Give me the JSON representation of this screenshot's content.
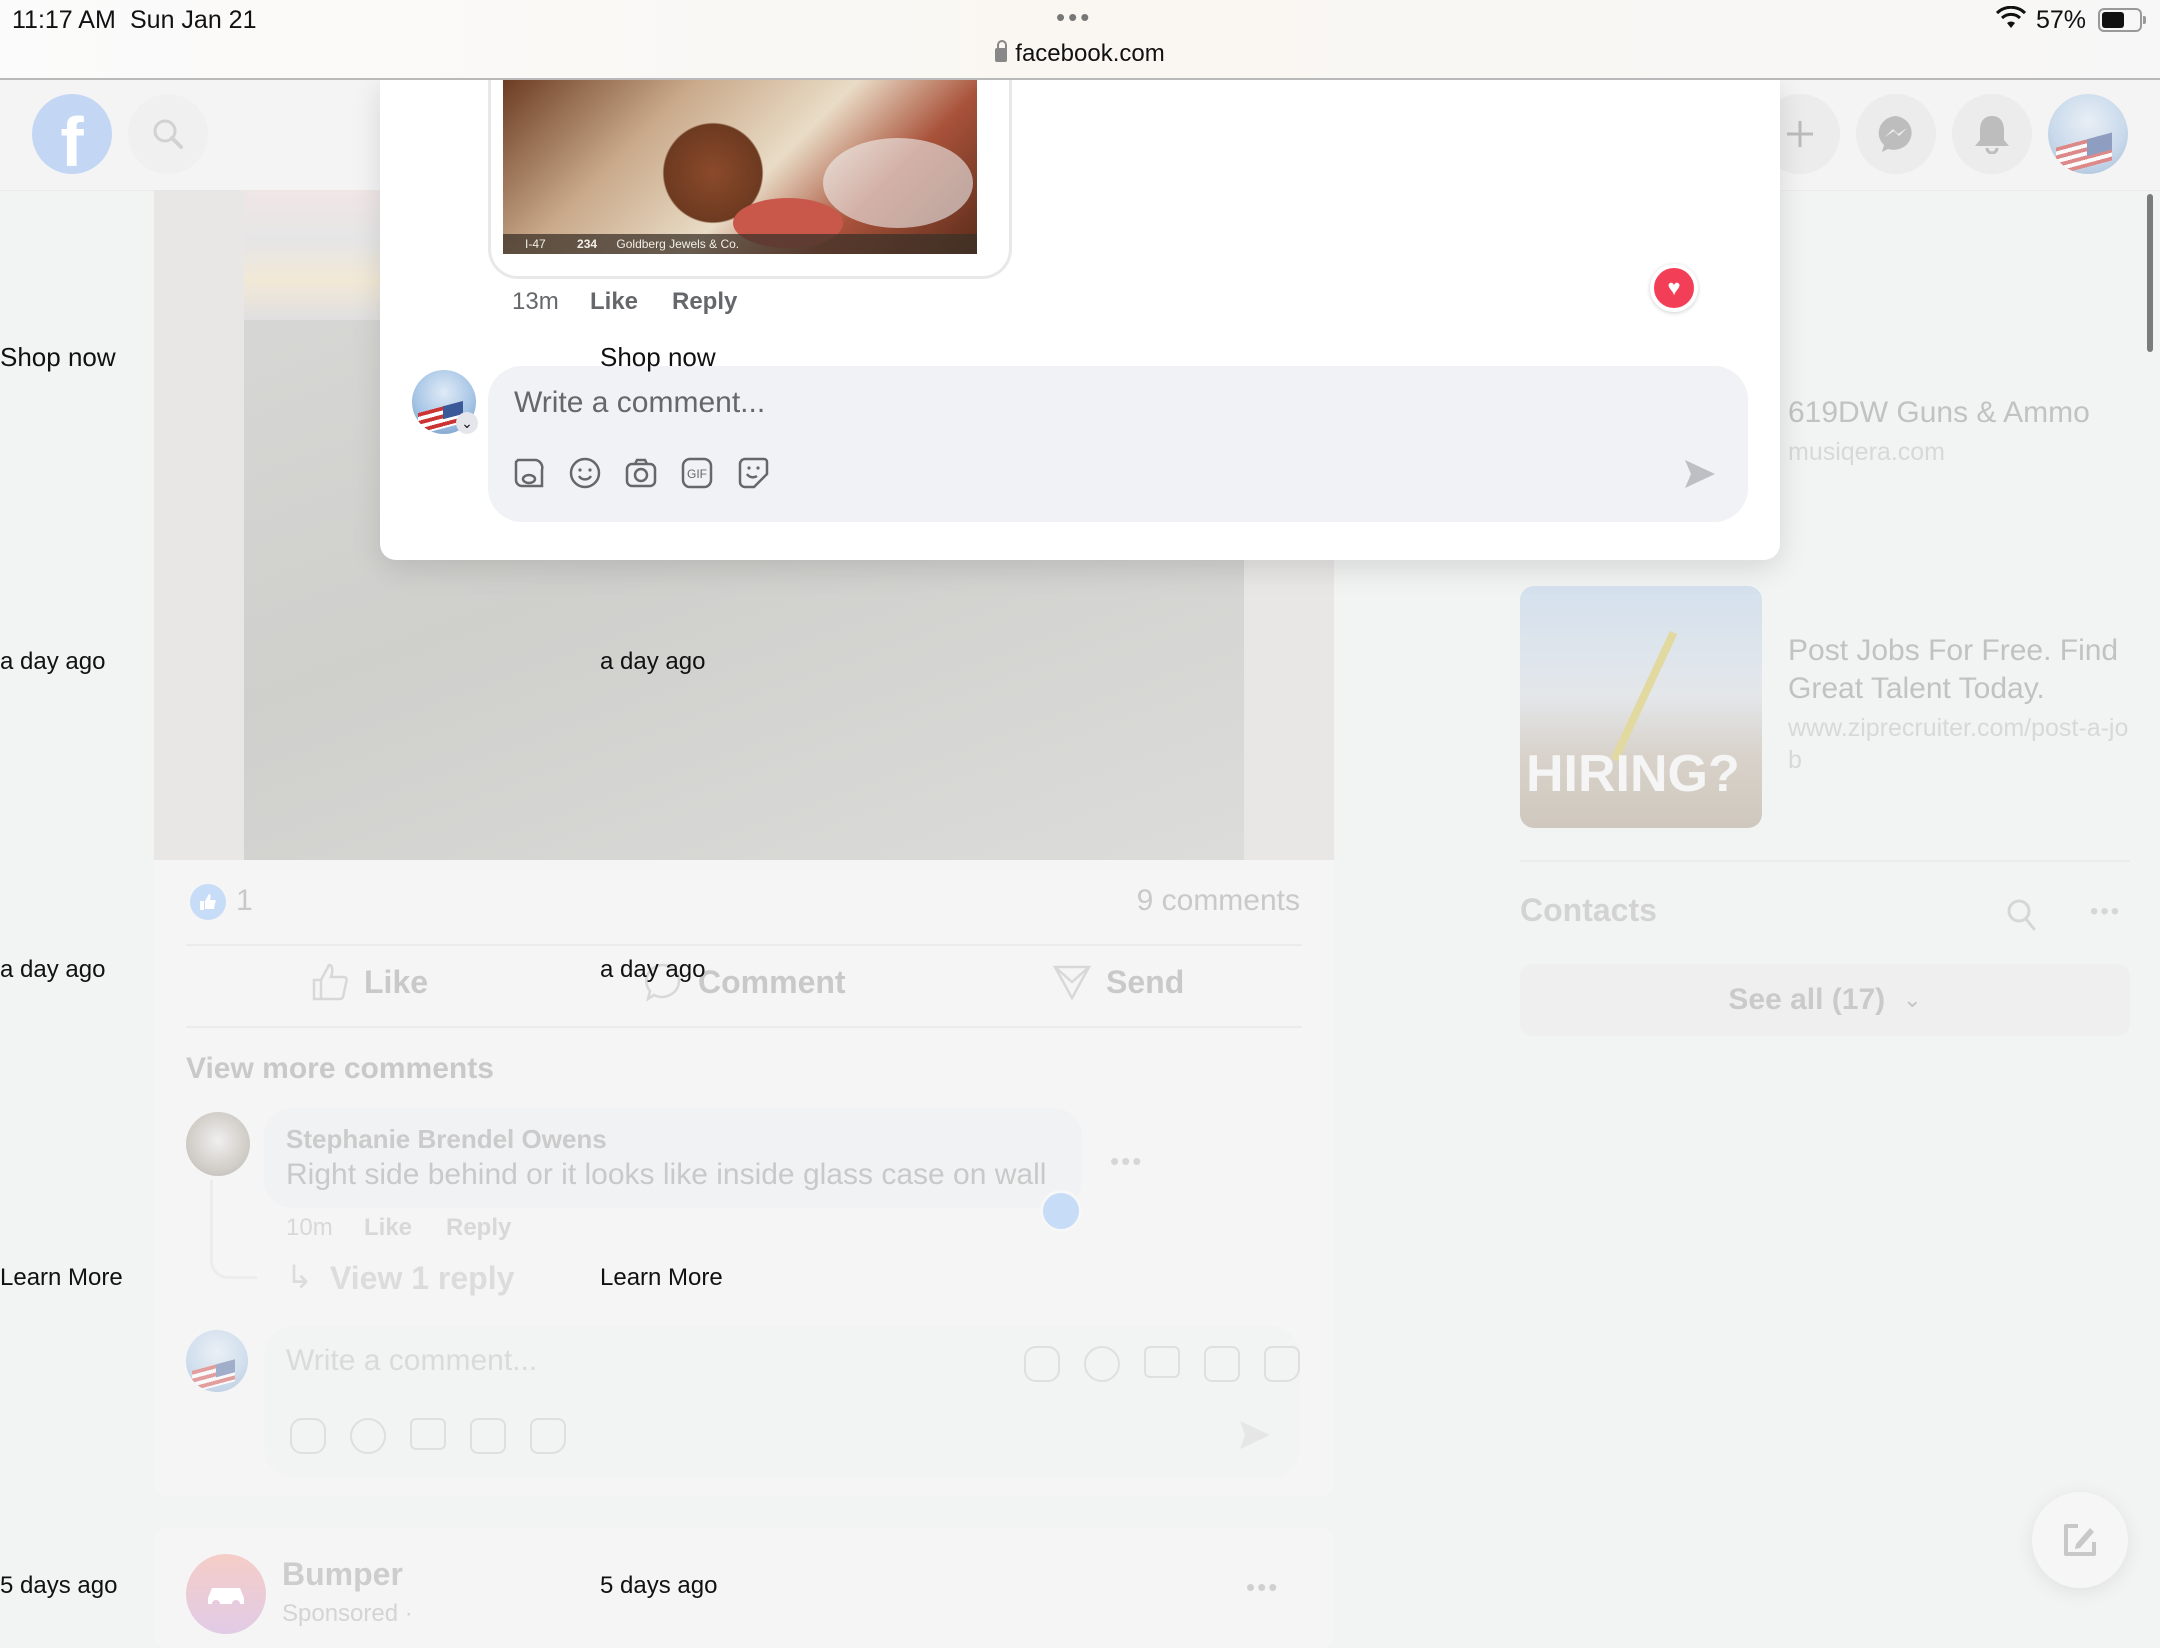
{
  "status_bar": {
    "time": "11:17 AM",
    "date": "Sun Jan 21",
    "dots": "•••",
    "url": "facebook.com",
    "battery_pct": "57%",
    "battery_level": 0.57
  },
  "fb_header": {
    "logo": "f",
    "icons": [
      "search-icon",
      "plus-icon",
      "messenger-icon",
      "bell-icon",
      "profile-avatar"
    ]
  },
  "modal": {
    "image_caption": {
      "level": "I-47",
      "score": "234",
      "location": "Goldberg Jewels & Co."
    },
    "comment_time": "13m",
    "like": "Like",
    "reply": "Reply",
    "reaction": "love",
    "composer_placeholder": "Write a comment...",
    "composer_tools": [
      "avatar-sticker-icon",
      "emoji-icon",
      "camera-icon",
      "gif-icon",
      "sticker-icon"
    ]
  },
  "post": {
    "reaction_count": "1",
    "comments_count": "9 comments",
    "actions": {
      "like": "Like",
      "comment": "Comment",
      "send": "Send"
    },
    "view_more": "View more comments",
    "comment": {
      "author": "Stephanie Brendel Owens",
      "text": "Right side behind or it looks like inside glass case on wall",
      "time": "10m",
      "like": "Like",
      "reply": "Reply",
      "view_replies": "View 1 reply"
    },
    "composer_placeholder": "Write a comment..."
  },
  "next_post": {
    "author": "Bumper",
    "sponsored": "Sponsored · "
  },
  "sidebar": {
    "ads": [
      {
        "title": "619DW Guns & Ammo",
        "url": "musiqera.com"
      },
      {
        "title": "Post Jobs For Free. Find Great Talent Today.",
        "url": "www.ziprecruiter.com/post-a-job",
        "image_text": "HIRING?"
      }
    ],
    "contacts_title": "Contacts",
    "see_all": "See all (17)"
  },
  "ghost_labels": {
    "shop_now": "Shop now",
    "a_day_ago": "a day ago",
    "learn_more": "Learn More",
    "five_days_ago": "5 days ago"
  }
}
